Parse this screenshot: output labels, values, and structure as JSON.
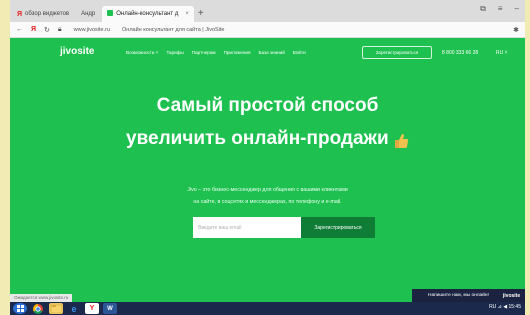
{
  "browser": {
    "tabs": [
      {
        "icon": "Я",
        "label": "обзор виджетов"
      },
      {
        "icon": "",
        "label": "Андр"
      },
      {
        "icon": "",
        "label": "Онлайн-консультант д"
      }
    ],
    "close_glyph": "×",
    "new_tab_glyph": "+",
    "window_controls": [
      "⧉",
      "≡",
      "–"
    ],
    "url_domain": "www.jivosite.ru",
    "url_title": "Онлайн консультант для сайта | JivoSite",
    "bookmark_glyph": "✱"
  },
  "site": {
    "logo": "jivosite",
    "nav": [
      "Возможности ˅",
      "Тарифы",
      "Партнерам",
      "Приложения",
      "База знаний",
      "Войти"
    ],
    "register_label": "Зарегистрироваться",
    "phone": "8 800 333 66 28",
    "lang": "RU ˅",
    "headline_1": "Самый простой способ",
    "headline_2": "увеличить онлайн-продажи",
    "sub_1": "Jivo – это бизнес-мессенджер для общения с вашими клиентами",
    "sub_2": "на сайте, в соцсетях и мессенджерах, по телефону и e-mail.",
    "email_placeholder": "Введите ваш email",
    "submit_label": "Зарегистрироваться"
  },
  "status_url": "Ожидается www.jivosite.ru",
  "chat": {
    "label": "Напишите нам, мы онлайн!",
    "brand": "jivosite"
  },
  "taskbar": {
    "apps": [
      "start",
      "chrome",
      "explorer",
      "ie",
      "yandex",
      "word"
    ],
    "tray": "RU  ⊿ ◀ 15:45"
  },
  "colors": {
    "brand_green": "#1ec14f",
    "button_dark_green": "#0f7d36",
    "taskbar": "#1b2a4c"
  }
}
